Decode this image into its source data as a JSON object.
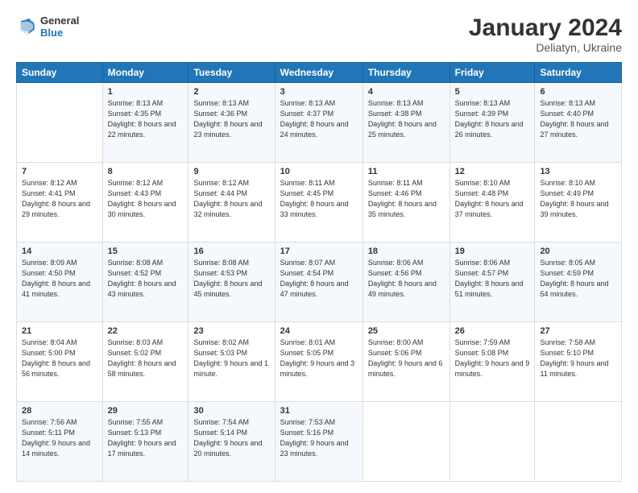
{
  "logo": {
    "general": "General",
    "blue": "Blue"
  },
  "header": {
    "month": "January 2024",
    "location": "Deliatyn, Ukraine"
  },
  "weekdays": [
    "Sunday",
    "Monday",
    "Tuesday",
    "Wednesday",
    "Thursday",
    "Friday",
    "Saturday"
  ],
  "weeks": [
    [
      {
        "day": "",
        "sunrise": "",
        "sunset": "",
        "daylight": ""
      },
      {
        "day": "1",
        "sunrise": "Sunrise: 8:13 AM",
        "sunset": "Sunset: 4:35 PM",
        "daylight": "Daylight: 8 hours and 22 minutes."
      },
      {
        "day": "2",
        "sunrise": "Sunrise: 8:13 AM",
        "sunset": "Sunset: 4:36 PM",
        "daylight": "Daylight: 8 hours and 23 minutes."
      },
      {
        "day": "3",
        "sunrise": "Sunrise: 8:13 AM",
        "sunset": "Sunset: 4:37 PM",
        "daylight": "Daylight: 8 hours and 24 minutes."
      },
      {
        "day": "4",
        "sunrise": "Sunrise: 8:13 AM",
        "sunset": "Sunset: 4:38 PM",
        "daylight": "Daylight: 8 hours and 25 minutes."
      },
      {
        "day": "5",
        "sunrise": "Sunrise: 8:13 AM",
        "sunset": "Sunset: 4:39 PM",
        "daylight": "Daylight: 8 hours and 26 minutes."
      },
      {
        "day": "6",
        "sunrise": "Sunrise: 8:13 AM",
        "sunset": "Sunset: 4:40 PM",
        "daylight": "Daylight: 8 hours and 27 minutes."
      }
    ],
    [
      {
        "day": "7",
        "sunrise": "Sunrise: 8:12 AM",
        "sunset": "Sunset: 4:41 PM",
        "daylight": "Daylight: 8 hours and 29 minutes."
      },
      {
        "day": "8",
        "sunrise": "Sunrise: 8:12 AM",
        "sunset": "Sunset: 4:43 PM",
        "daylight": "Daylight: 8 hours and 30 minutes."
      },
      {
        "day": "9",
        "sunrise": "Sunrise: 8:12 AM",
        "sunset": "Sunset: 4:44 PM",
        "daylight": "Daylight: 8 hours and 32 minutes."
      },
      {
        "day": "10",
        "sunrise": "Sunrise: 8:11 AM",
        "sunset": "Sunset: 4:45 PM",
        "daylight": "Daylight: 8 hours and 33 minutes."
      },
      {
        "day": "11",
        "sunrise": "Sunrise: 8:11 AM",
        "sunset": "Sunset: 4:46 PM",
        "daylight": "Daylight: 8 hours and 35 minutes."
      },
      {
        "day": "12",
        "sunrise": "Sunrise: 8:10 AM",
        "sunset": "Sunset: 4:48 PM",
        "daylight": "Daylight: 8 hours and 37 minutes."
      },
      {
        "day": "13",
        "sunrise": "Sunrise: 8:10 AM",
        "sunset": "Sunset: 4:49 PM",
        "daylight": "Daylight: 8 hours and 39 minutes."
      }
    ],
    [
      {
        "day": "14",
        "sunrise": "Sunrise: 8:09 AM",
        "sunset": "Sunset: 4:50 PM",
        "daylight": "Daylight: 8 hours and 41 minutes."
      },
      {
        "day": "15",
        "sunrise": "Sunrise: 8:08 AM",
        "sunset": "Sunset: 4:52 PM",
        "daylight": "Daylight: 8 hours and 43 minutes."
      },
      {
        "day": "16",
        "sunrise": "Sunrise: 8:08 AM",
        "sunset": "Sunset: 4:53 PM",
        "daylight": "Daylight: 8 hours and 45 minutes."
      },
      {
        "day": "17",
        "sunrise": "Sunrise: 8:07 AM",
        "sunset": "Sunset: 4:54 PM",
        "daylight": "Daylight: 8 hours and 47 minutes."
      },
      {
        "day": "18",
        "sunrise": "Sunrise: 8:06 AM",
        "sunset": "Sunset: 4:56 PM",
        "daylight": "Daylight: 8 hours and 49 minutes."
      },
      {
        "day": "19",
        "sunrise": "Sunrise: 8:06 AM",
        "sunset": "Sunset: 4:57 PM",
        "daylight": "Daylight: 8 hours and 51 minutes."
      },
      {
        "day": "20",
        "sunrise": "Sunrise: 8:05 AM",
        "sunset": "Sunset: 4:59 PM",
        "daylight": "Daylight: 8 hours and 54 minutes."
      }
    ],
    [
      {
        "day": "21",
        "sunrise": "Sunrise: 8:04 AM",
        "sunset": "Sunset: 5:00 PM",
        "daylight": "Daylight: 8 hours and 56 minutes."
      },
      {
        "day": "22",
        "sunrise": "Sunrise: 8:03 AM",
        "sunset": "Sunset: 5:02 PM",
        "daylight": "Daylight: 8 hours and 58 minutes."
      },
      {
        "day": "23",
        "sunrise": "Sunrise: 8:02 AM",
        "sunset": "Sunset: 5:03 PM",
        "daylight": "Daylight: 9 hours and 1 minute."
      },
      {
        "day": "24",
        "sunrise": "Sunrise: 8:01 AM",
        "sunset": "Sunset: 5:05 PM",
        "daylight": "Daylight: 9 hours and 3 minutes."
      },
      {
        "day": "25",
        "sunrise": "Sunrise: 8:00 AM",
        "sunset": "Sunset: 5:06 PM",
        "daylight": "Daylight: 9 hours and 6 minutes."
      },
      {
        "day": "26",
        "sunrise": "Sunrise: 7:59 AM",
        "sunset": "Sunset: 5:08 PM",
        "daylight": "Daylight: 9 hours and 9 minutes."
      },
      {
        "day": "27",
        "sunrise": "Sunrise: 7:58 AM",
        "sunset": "Sunset: 5:10 PM",
        "daylight": "Daylight: 9 hours and 11 minutes."
      }
    ],
    [
      {
        "day": "28",
        "sunrise": "Sunrise: 7:56 AM",
        "sunset": "Sunset: 5:11 PM",
        "daylight": "Daylight: 9 hours and 14 minutes."
      },
      {
        "day": "29",
        "sunrise": "Sunrise: 7:55 AM",
        "sunset": "Sunset: 5:13 PM",
        "daylight": "Daylight: 9 hours and 17 minutes."
      },
      {
        "day": "30",
        "sunrise": "Sunrise: 7:54 AM",
        "sunset": "Sunset: 5:14 PM",
        "daylight": "Daylight: 9 hours and 20 minutes."
      },
      {
        "day": "31",
        "sunrise": "Sunrise: 7:53 AM",
        "sunset": "Sunset: 5:16 PM",
        "daylight": "Daylight: 9 hours and 23 minutes."
      },
      {
        "day": "",
        "sunrise": "",
        "sunset": "",
        "daylight": ""
      },
      {
        "day": "",
        "sunrise": "",
        "sunset": "",
        "daylight": ""
      },
      {
        "day": "",
        "sunrise": "",
        "sunset": "",
        "daylight": ""
      }
    ]
  ]
}
